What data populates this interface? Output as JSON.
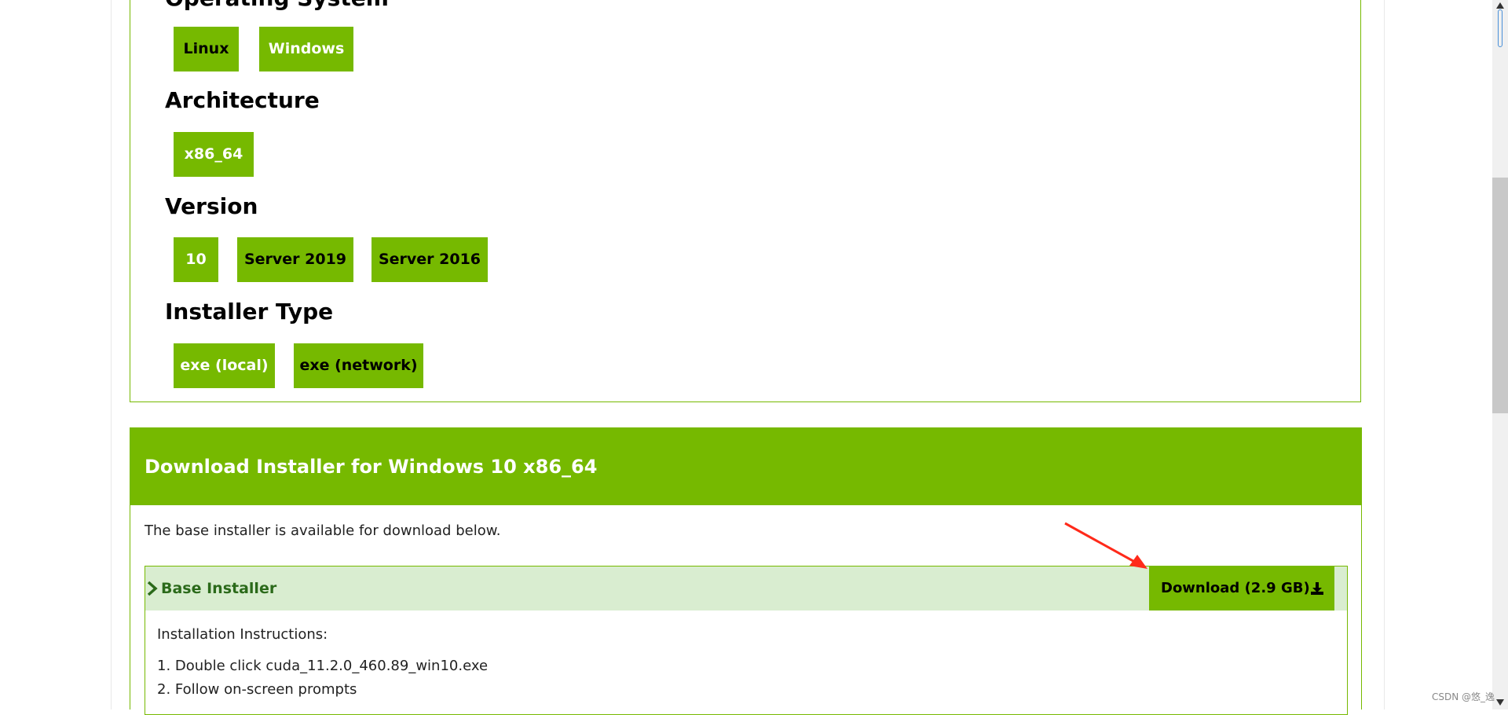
{
  "sections": {
    "operating_system": {
      "title": "Operating System",
      "options": [
        {
          "label": "Linux",
          "selected": false
        },
        {
          "label": "Windows",
          "selected": true
        }
      ]
    },
    "architecture": {
      "title": "Architecture",
      "options": [
        {
          "label": "x86_64",
          "selected": true
        }
      ]
    },
    "version": {
      "title": "Version",
      "options": [
        {
          "label": "10",
          "selected": true
        },
        {
          "label": "Server 2019",
          "selected": false
        },
        {
          "label": "Server 2016",
          "selected": false
        }
      ]
    },
    "installer_type": {
      "title": "Installer Type",
      "options": [
        {
          "label": "exe (local)",
          "selected": true
        },
        {
          "label": "exe (network)",
          "selected": false
        }
      ]
    }
  },
  "download": {
    "title": "Download Installer for Windows 10 x86_64",
    "description": "The base installer is available for download below.",
    "base_installer": {
      "label": "Base Installer",
      "download_label": "Download (2.9 GB)",
      "instructions_title": "Installation Instructions:",
      "steps": [
        "1. Double click cuda_11.2.0_460.89_win10.exe",
        "2. Follow on-screen prompts"
      ]
    }
  },
  "watermark": "CSDN @悠_逸",
  "colors": {
    "accent": "#76b900",
    "installer_header_bg": "#d9edd0",
    "installer_label": "#2b6a1a",
    "annotation_arrow": "#ff2a1a"
  },
  "icons": {
    "expand": "chevron-right-icon",
    "download": "download-icon"
  }
}
